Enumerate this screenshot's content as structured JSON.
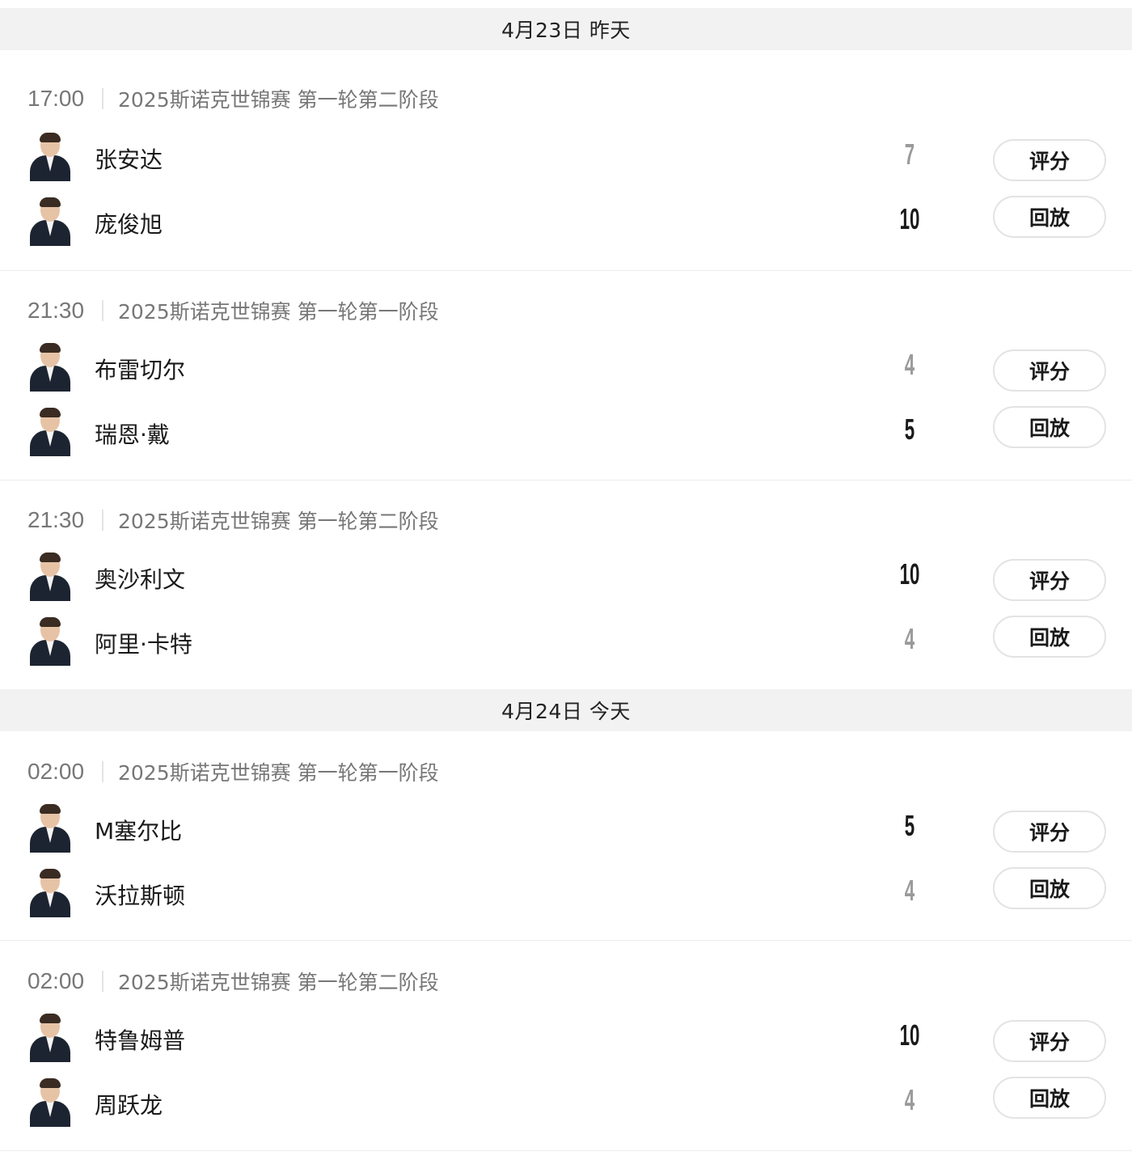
{
  "days": [
    {
      "label": "4月23日 昨天"
    },
    {
      "label": "4月24日 今天"
    }
  ],
  "buttons": {
    "rate": "评分",
    "replay": "回放"
  },
  "matches": [
    {
      "time": "17:00",
      "title": "2025斯诺克世锦赛 第一轮第二阶段",
      "players": [
        {
          "name": "张安达",
          "score": "7",
          "winner": false
        },
        {
          "name": "庞俊旭",
          "score": "10",
          "winner": true
        }
      ]
    },
    {
      "time": "21:30",
      "title": "2025斯诺克世锦赛 第一轮第一阶段",
      "players": [
        {
          "name": "布雷切尔",
          "score": "4",
          "winner": false
        },
        {
          "name": "瑞恩·戴",
          "score": "5",
          "winner": true
        }
      ]
    },
    {
      "time": "21:30",
      "title": "2025斯诺克世锦赛 第一轮第二阶段",
      "players": [
        {
          "name": "奥沙利文",
          "score": "10",
          "winner": true
        },
        {
          "name": "阿里·卡特",
          "score": "4",
          "winner": false
        }
      ]
    },
    {
      "time": "02:00",
      "title": "2025斯诺克世锦赛 第一轮第一阶段",
      "players": [
        {
          "name": "M塞尔比",
          "score": "5",
          "winner": true
        },
        {
          "name": "沃拉斯顿",
          "score": "4",
          "winner": false
        }
      ]
    },
    {
      "time": "02:00",
      "title": "2025斯诺克世锦赛 第一轮第二阶段",
      "players": [
        {
          "name": "特鲁姆普",
          "score": "10",
          "winner": true
        },
        {
          "name": "周跃龙",
          "score": "4",
          "winner": false
        }
      ]
    }
  ]
}
